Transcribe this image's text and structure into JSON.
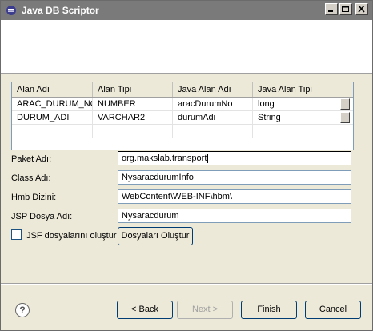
{
  "window": {
    "title": "Java DB Scriptor",
    "minimize_label": "_",
    "maximize_label": "□",
    "close_label": "×"
  },
  "table": {
    "columns": [
      "Alan Adı",
      "Alan Tipi",
      "Java Alan Adı",
      "Java Alan Tipi"
    ],
    "rows": [
      [
        "ARAC_DURUM_NO",
        "NUMBER",
        "aracDurumNo",
        "long"
      ],
      [
        "DURUM_ADI",
        "VARCHAR2",
        "durumAdi",
        "String"
      ]
    ]
  },
  "form": {
    "paket_label": "Paket Adı:",
    "paket_value": "org.makslab.transport",
    "class_label": "Class Adı:",
    "class_value": "NysaracdurumInfo",
    "hmb_label": "Hmb Dizini:",
    "hmb_value": "WebContent\\WEB-INF\\hbm\\",
    "jsp_label": "JSP Dosya Adı:",
    "jsp_value": "Nysaracdurum",
    "jsf_checkbox_label": "JSF dosyalarını oluştur",
    "create_files_button": "Dosyaları Oluştur"
  },
  "footer": {
    "help_icon": "?",
    "back_button": "< Back",
    "next_button": "Next >",
    "finish_button": "Finish",
    "cancel_button": "Cancel"
  }
}
